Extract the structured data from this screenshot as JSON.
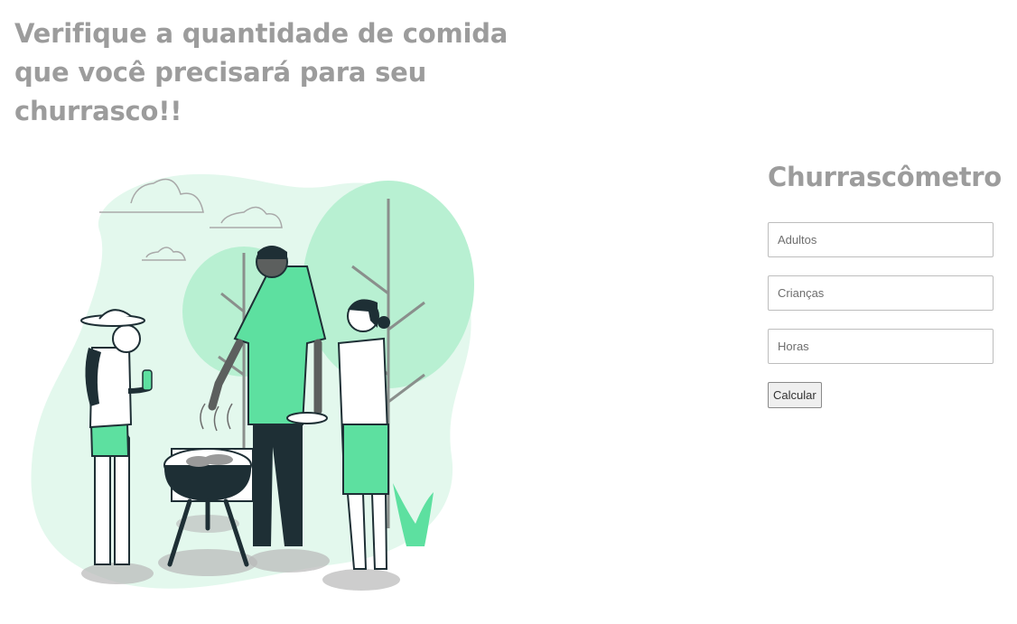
{
  "header": {
    "headline": "Verifique a quantidade de comida que você precisará para seu churrasco!!"
  },
  "form": {
    "title": "Churrascômetro",
    "adults_placeholder": "Adultos",
    "children_placeholder": "Crianças",
    "hours_placeholder": "Horas",
    "submit_label": "Calcular"
  },
  "colors": {
    "accent_green": "#5de0a0",
    "dark": "#1e2f35",
    "light_green": "#e3f8ed",
    "title_gray": "#9c9c9c"
  }
}
